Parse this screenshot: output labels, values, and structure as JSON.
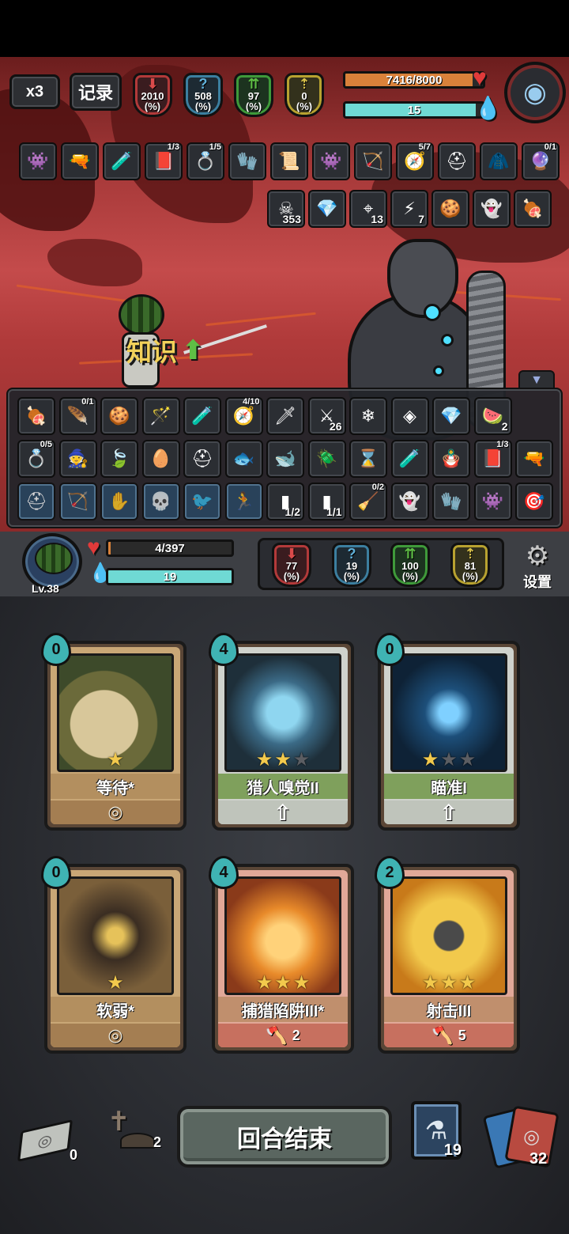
{
  "speed_button": "x3",
  "log_button": "记录",
  "enemy": {
    "stats": [
      {
        "value": "2010",
        "unit": "(%)",
        "color": "red",
        "icon": "attack-icon"
      },
      {
        "value": "508",
        "unit": "(%)",
        "color": "blue",
        "icon": "question-icon"
      },
      {
        "value": "97",
        "unit": "(%)",
        "color": "green",
        "icon": "defense-icon"
      },
      {
        "value": "0",
        "unit": "(%)",
        "color": "yellow",
        "icon": "luck-icon"
      }
    ],
    "hp": "7416/8000",
    "hp_fraction": 0.927,
    "energy": "15",
    "energy_fraction": 0.95,
    "relics_row1": [
      {
        "icon": "red-creature-icon",
        "count": ""
      },
      {
        "icon": "gun-icon",
        "count": ""
      },
      {
        "icon": "potion-bag-icon",
        "count": ""
      },
      {
        "icon": "spellbook-icon",
        "count": "1/3"
      },
      {
        "icon": "gold-ring-icon",
        "count": "1/5"
      },
      {
        "icon": "gauntlet-icon",
        "count": ""
      },
      {
        "icon": "scroll-icon",
        "count": ""
      },
      {
        "icon": "red-creature-icon",
        "count": ""
      },
      {
        "icon": "crossbow-icon",
        "count": ""
      },
      {
        "icon": "compass-icon",
        "count": "5/7"
      },
      {
        "icon": "spiked-helmet-icon",
        "count": ""
      },
      {
        "icon": "cloak-icon",
        "count": ""
      },
      {
        "icon": "amulet-icon",
        "count": "0/1"
      }
    ],
    "buffs": [
      {
        "icon": "poison-skull-icon",
        "num": "353"
      },
      {
        "icon": "crystal-icon",
        "num": ""
      },
      {
        "icon": "target-icon",
        "num": "13"
      },
      {
        "icon": "bleed-claw-icon",
        "num": "7"
      },
      {
        "icon": "cookie-icon",
        "num": ""
      },
      {
        "icon": "ghost-icon",
        "num": ""
      },
      {
        "icon": "meat-bone-icon",
        "num": ""
      }
    ]
  },
  "floating_text": "知识",
  "inventory": {
    "row1": [
      {
        "icon": "meat-bone-icon",
        "count": ""
      },
      {
        "icon": "wing-icon",
        "count": "0/1"
      },
      {
        "icon": "cookie-icon",
        "count": ""
      },
      {
        "icon": "wand-icon",
        "count": ""
      },
      {
        "icon": "potion-bag-icon",
        "count": ""
      },
      {
        "icon": "compass-icon",
        "count": "4/10"
      },
      {
        "icon": "dagger-icon",
        "count": ""
      },
      {
        "icon": "green-slash-icon",
        "num": "26"
      },
      {
        "icon": "crystal-cluster-icon",
        "num": ""
      },
      {
        "icon": "rune-stone-icon",
        "num": ""
      },
      {
        "icon": "crystal-icon",
        "num": ""
      },
      {
        "icon": "melon-slice-icon",
        "num": "2"
      }
    ],
    "row2": [
      {
        "icon": "gold-ring-icon",
        "count": "0/5"
      },
      {
        "icon": "gnome-icon",
        "count": ""
      },
      {
        "icon": "leaf-icon",
        "count": ""
      },
      {
        "icon": "dragon-egg-icon",
        "count": ""
      },
      {
        "icon": "helmet-icon",
        "count": ""
      },
      {
        "icon": "fish-icon",
        "count": ""
      },
      {
        "icon": "whale-icon",
        "count": ""
      },
      {
        "icon": "beetle-icon",
        "count": ""
      },
      {
        "icon": "hourglass-icon",
        "count": ""
      },
      {
        "icon": "potion-bag-icon",
        "count": ""
      },
      {
        "icon": "doll-icon",
        "count": ""
      },
      {
        "icon": "spellbook-icon",
        "count": "1/3"
      },
      {
        "icon": "gun-icon",
        "count": ""
      }
    ],
    "row3": [
      {
        "icon": "locked-helmet-icon",
        "count": ""
      },
      {
        "icon": "locked-bow-icon",
        "count": ""
      },
      {
        "icon": "locked-claw-icon",
        "count": ""
      },
      {
        "icon": "locked-skull-icon",
        "count": ""
      },
      {
        "icon": "locked-bird-icon",
        "count": ""
      },
      {
        "icon": "locked-runner-icon",
        "count": ""
      },
      {
        "icon": "bullet-icon",
        "num": "1/2"
      },
      {
        "icon": "purple-bullet-icon",
        "num": "1/1"
      },
      {
        "icon": "witch-icon",
        "count": "0/2"
      },
      {
        "icon": "ghost-icon",
        "count": ""
      },
      {
        "icon": "gauntlet-icon",
        "count": ""
      },
      {
        "icon": "red-creature-icon",
        "count": ""
      },
      {
        "icon": "arrow-quiver-icon",
        "count": ""
      }
    ]
  },
  "player": {
    "level": "Lv.38",
    "hp": "4/397",
    "hp_fraction": 0.01,
    "energy": "19",
    "energy_fraction": 1.0,
    "stats": [
      {
        "value": "77",
        "unit": "(%)",
        "color": "red"
      },
      {
        "value": "19",
        "unit": "(%)",
        "color": "blue"
      },
      {
        "value": "100",
        "unit": "(%)",
        "color": "green"
      },
      {
        "value": "81",
        "unit": "(%)",
        "color": "yellow"
      }
    ],
    "settings_label": "设置"
  },
  "cards": [
    {
      "name": "等待*",
      "cost": "0",
      "stars": 1,
      "style": "beige",
      "footer": "",
      "footer_icon": "spiral-icon",
      "art": "bow-art"
    },
    {
      "name": "猎人嗅觉II",
      "cost": "4",
      "stars": 2,
      "style": "gray",
      "footer": "",
      "footer_icon": "up-arrow-icon",
      "art": "hunter-face-art"
    },
    {
      "name": "瞄准I",
      "cost": "0",
      "stars": 1,
      "style": "gray",
      "footer": "",
      "footer_icon": "up-arrow-icon",
      "art": "crosshair-art"
    },
    {
      "name": "软弱*",
      "cost": "0",
      "stars": 1,
      "style": "beige",
      "footer": "",
      "footer_icon": "spiral-icon",
      "art": "weak-figure-art"
    },
    {
      "name": "捕猎陷阱III*",
      "cost": "4",
      "stars": 3,
      "style": "red",
      "footer": "2",
      "footer_icon": "axe-icon",
      "art": "bear-trap-art"
    },
    {
      "name": "射击III",
      "cost": "2",
      "stars": 3,
      "style": "red",
      "footer": "5",
      "footer_icon": "axe-icon",
      "art": "cannonball-art"
    }
  ],
  "bottom": {
    "discard_count": "0",
    "grave_count": "2",
    "end_turn": "回合结束",
    "potion_count": "19",
    "draw_count": "32"
  }
}
